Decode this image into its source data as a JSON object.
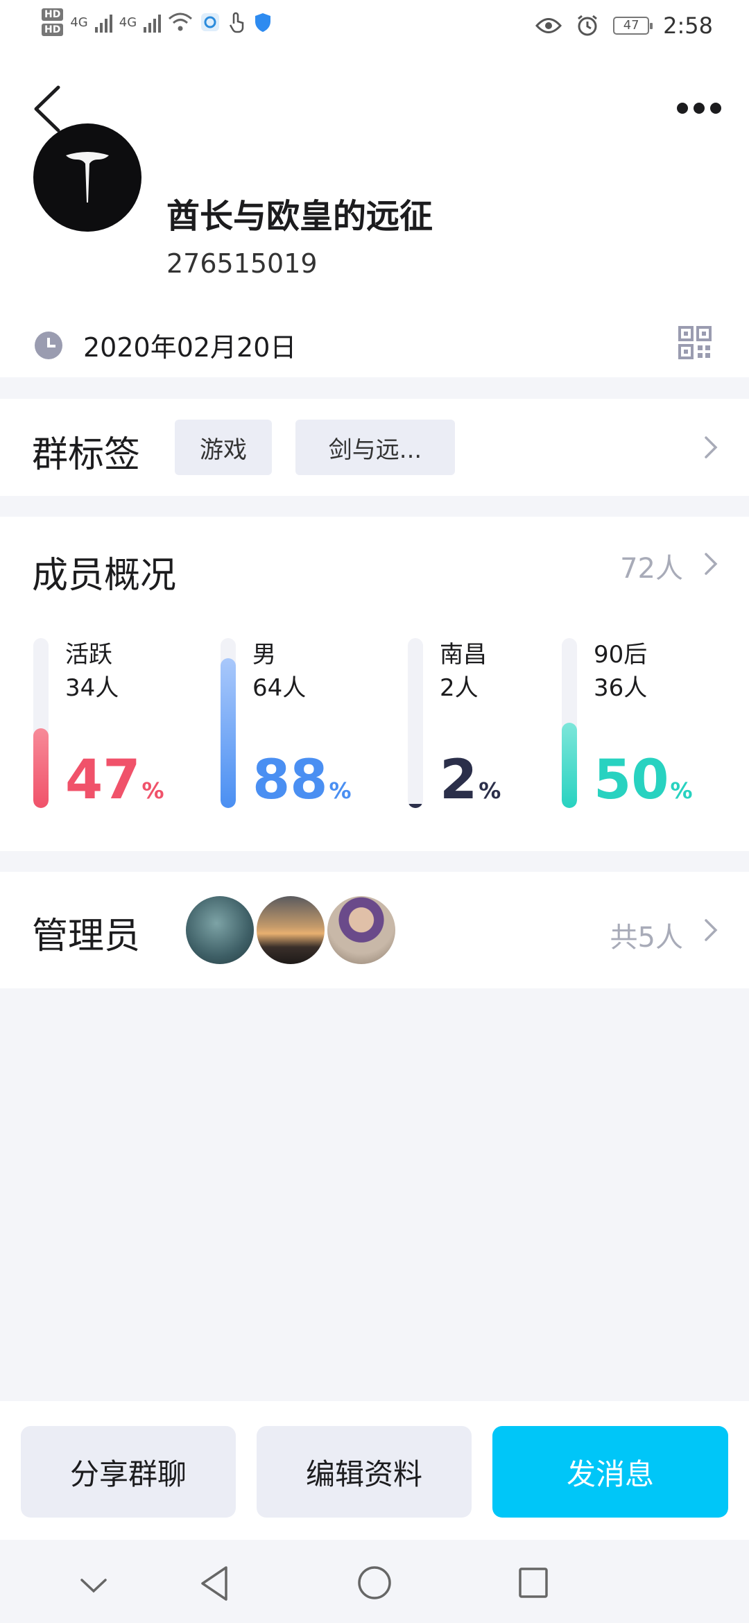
{
  "status_bar": {
    "hd1": "HD",
    "hd2": "HD",
    "net1": "4G",
    "net2": "4G",
    "battery": "47",
    "time": "2:58"
  },
  "group": {
    "name": "酋长与欧皇的远征",
    "id": "276515019",
    "date": "2020年02月20日"
  },
  "tags": {
    "title": "群标签",
    "items": [
      "游戏",
      "剑与远..."
    ]
  },
  "members": {
    "title": "成员概况",
    "count": "72人",
    "stats": [
      {
        "label": "活跃",
        "count": "34人",
        "percent": "47",
        "unit": "%",
        "color": "#f0526a",
        "level": 0.47
      },
      {
        "label": "男",
        "count": "64人",
        "percent": "88",
        "unit": "%",
        "color": "#4a8ff2",
        "level": 0.88
      },
      {
        "label": "南昌",
        "count": "2人",
        "percent": "2",
        "unit": "%",
        "color": "#2b2f4a",
        "level": 0.02
      },
      {
        "label": "90后",
        "count": "36人",
        "percent": "50",
        "unit": "%",
        "color": "#28d2c0",
        "level": 0.5
      }
    ]
  },
  "admins": {
    "title": "管理员",
    "total": "共5人"
  },
  "actions": {
    "share": "分享群聊",
    "edit": "编辑资料",
    "message": "发消息"
  }
}
